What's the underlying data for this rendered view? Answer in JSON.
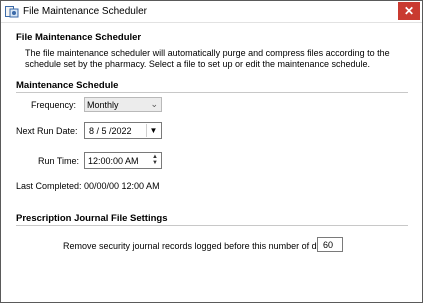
{
  "window": {
    "title": "File Maintenance Scheduler",
    "close_glyph": "✕",
    "accent_close": "#c93a30"
  },
  "section_top": {
    "title": "File Maintenance Scheduler",
    "description": "The file maintenance scheduler will automatically purge and compress files according to the schedule set by the pharmacy. Select a file to set up or edit the maintenance schedule."
  },
  "maintenance_schedule": {
    "title": "Maintenance Schedule",
    "frequency_label": "Frequency:",
    "frequency_value": "Monthly",
    "next_run_label": "Next Run Date:",
    "next_run_value": "8 / 5 /2022",
    "run_time_label": "Run Time:",
    "run_time_value": "12:00:00 AM",
    "last_completed_label": "Last Completed:",
    "last_completed_value": "00/00/00 12:00 AM"
  },
  "journal_settings": {
    "title": "Prescription Journal File Settings",
    "remove_label": "Remove security journal records logged before this number of days:",
    "days_value": "60"
  },
  "icons": {
    "app": "file-maintenance-app-icon",
    "frequency_chevron": "chevron-down-icon",
    "date_dropdown": "dropdown-arrow-icon",
    "spin_up": "spin-up-icon",
    "spin_down": "spin-down-icon"
  }
}
